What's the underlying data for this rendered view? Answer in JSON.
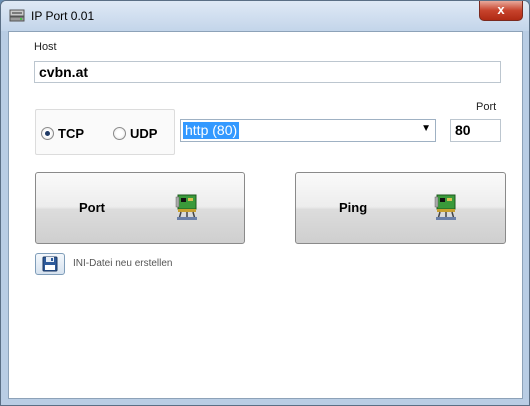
{
  "window": {
    "title": "IP Port 0.01",
    "close_glyph": "x",
    "icon": "network-app-icon"
  },
  "form": {
    "host_label": "Host",
    "host_value": "cvbn.at",
    "protocols": [
      {
        "label": "TCP",
        "checked": true
      },
      {
        "label": "UDP",
        "checked": false
      }
    ],
    "service_value": "http (80)",
    "port_label": "Port",
    "port_value": "80"
  },
  "buttons": {
    "port_label": "Port",
    "ping_label": "Ping",
    "button_icon": "network-card-icon"
  },
  "ini": {
    "icon": "save-icon",
    "label": "INI-Datei neu erstellen"
  },
  "colors": {
    "selection": "#3399ff",
    "close_button": "#c7432c",
    "chrome": "#b9cde4"
  }
}
